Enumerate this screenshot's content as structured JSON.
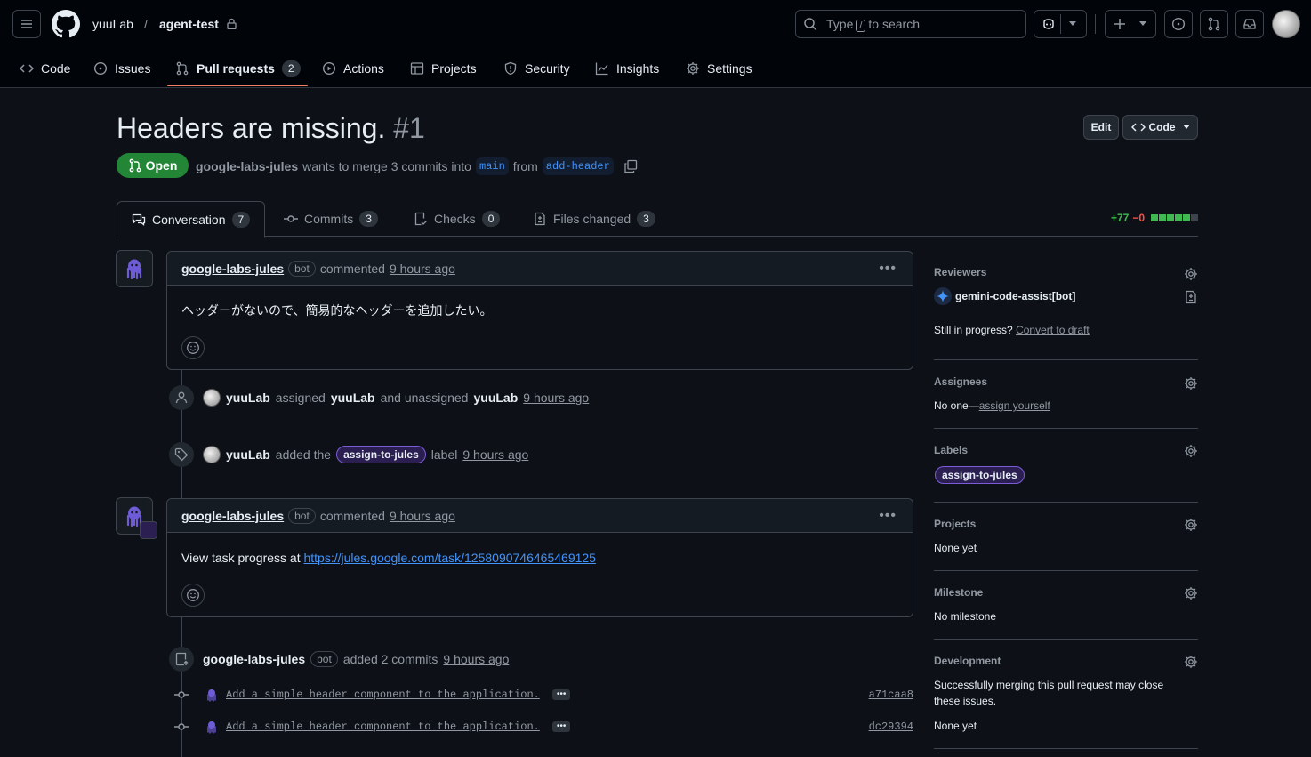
{
  "header": {
    "owner": "yuuLab",
    "separator": "/",
    "repo": "agent-test",
    "search_prefix": "Type",
    "search_key": "/",
    "search_suffix": "to search"
  },
  "nav": {
    "code": "Code",
    "issues": "Issues",
    "pull_requests": "Pull requests",
    "pull_requests_count": "2",
    "actions": "Actions",
    "projects": "Projects",
    "security": "Security",
    "insights": "Insights",
    "settings": "Settings"
  },
  "pr": {
    "title": "Headers are missing.",
    "number": "#1",
    "edit_label": "Edit",
    "code_label": "Code",
    "state": "Open",
    "author": "google-labs-jules",
    "merge_text": "wants to merge 3 commits into",
    "base_branch": "main",
    "from_text": "from",
    "head_branch": "add-header"
  },
  "tabs": {
    "conversation": "Conversation",
    "conversation_count": "7",
    "commits": "Commits",
    "commits_count": "3",
    "checks": "Checks",
    "checks_count": "0",
    "files": "Files changed",
    "files_count": "3",
    "additions": "+77",
    "deletions": "−0"
  },
  "comment1": {
    "author": "google-labs-jules",
    "bot": "bot",
    "action": "commented",
    "time": "9 hours ago",
    "body": "ヘッダーがないので、簡易的なヘッダーを追加したい。"
  },
  "event_assign": {
    "actor": "yuuLab",
    "text1": "assigned",
    "target1": "yuuLab",
    "text2": "and unassigned",
    "target2": "yuuLab",
    "time": "9 hours ago"
  },
  "event_label": {
    "actor": "yuuLab",
    "text1": "added the",
    "label": "assign-to-jules",
    "text2": "label",
    "time": "9 hours ago"
  },
  "comment2": {
    "author": "google-labs-jules",
    "bot": "bot",
    "action": "commented",
    "time": "9 hours ago",
    "body_prefix": "View task progress at",
    "link": "https://jules.google.com/task/1258090746465469125"
  },
  "event_commits": {
    "actor": "google-labs-jules",
    "bot": "bot",
    "text": "added 2 commits",
    "time": "9 hours ago",
    "commits": [
      {
        "message": "Add a simple header component to the application.",
        "sha": "a71caa8"
      },
      {
        "message": "Add a simple header component to the application.",
        "sha": "dc29394"
      }
    ]
  },
  "sidebar": {
    "reviewers_title": "Reviewers",
    "reviewer": "gemini-code-assist[bot]",
    "in_progress": "Still in progress?",
    "convert_draft": "Convert to draft",
    "assignees_title": "Assignees",
    "assignees_none": "No one—",
    "assign_yourself": "assign yourself",
    "labels_title": "Labels",
    "label": "assign-to-jules",
    "projects_title": "Projects",
    "projects_value": "None yet",
    "milestone_title": "Milestone",
    "milestone_value": "No milestone",
    "development_title": "Development",
    "development_text": "Successfully merging this pull request may close these issues.",
    "development_value": "None yet"
  },
  "colors": {
    "background": "#0d1117",
    "open_green": "#238636",
    "link_blue": "#4493f8",
    "tab_underline": "#f78166",
    "label_purple": "#7b5bd6"
  }
}
